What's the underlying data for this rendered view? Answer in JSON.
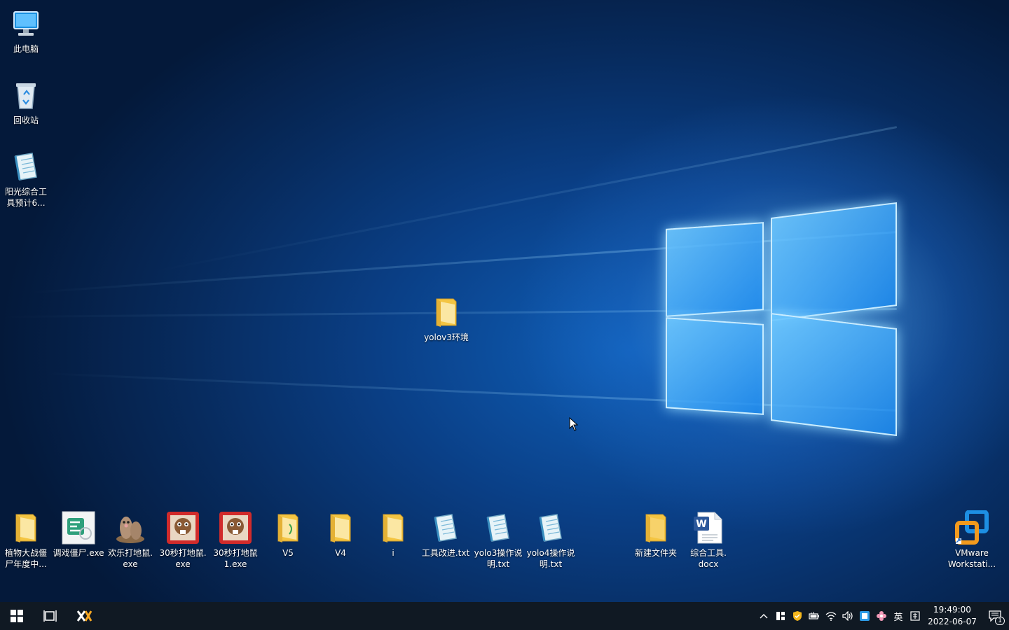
{
  "desktop": {
    "left_icons": [
      {
        "label": "此电脑",
        "icon": "computer-icon"
      },
      {
        "label": "回收站",
        "icon": "recycle-bin-icon"
      },
      {
        "label": "阳光综合工\n具预计6...",
        "icon": "text-document-icon"
      }
    ],
    "floating_icon": {
      "label": "yolov3环境",
      "icon": "folder-icon"
    },
    "bottom_icons": [
      {
        "label": "植物大战僵\n尸年度中...",
        "icon": "folder-icon"
      },
      {
        "label": "调戏僵尸.exe",
        "icon": "app-exe-icon"
      },
      {
        "label": "欢乐打地鼠.\nexe",
        "icon": "mole-game-icon"
      },
      {
        "label": "30秒打地鼠.\nexe",
        "icon": "mole-game-red-icon"
      },
      {
        "label": "30秒打地鼠\n1.exe",
        "icon": "mole-game-red-icon"
      },
      {
        "label": "V5",
        "icon": "folder-icon"
      },
      {
        "label": "V4",
        "icon": "folder-icon"
      },
      {
        "label": "i",
        "icon": "folder-icon"
      },
      {
        "label": "工具改进.txt",
        "icon": "text-document-icon"
      },
      {
        "label": "yolo3操作说\n明.txt",
        "icon": "text-document-icon"
      },
      {
        "label": "yolo4操作说\n明.txt",
        "icon": "text-document-icon"
      },
      {
        "label": "新建文件夹",
        "icon": "folder-icon"
      },
      {
        "label": "综合工具.\ndocx",
        "icon": "word-document-icon"
      }
    ],
    "right_icon": {
      "label": "VMware\nWorkstati...",
      "icon": "vmware-icon"
    }
  },
  "taskbar": {
    "tray_ime": "英",
    "time": "19:49:00",
    "date": "2022-06-07",
    "notification_count": "1"
  },
  "colors": {
    "taskbar": "#101923",
    "folder": "#f4c542",
    "accent": "#1e8cf0"
  }
}
